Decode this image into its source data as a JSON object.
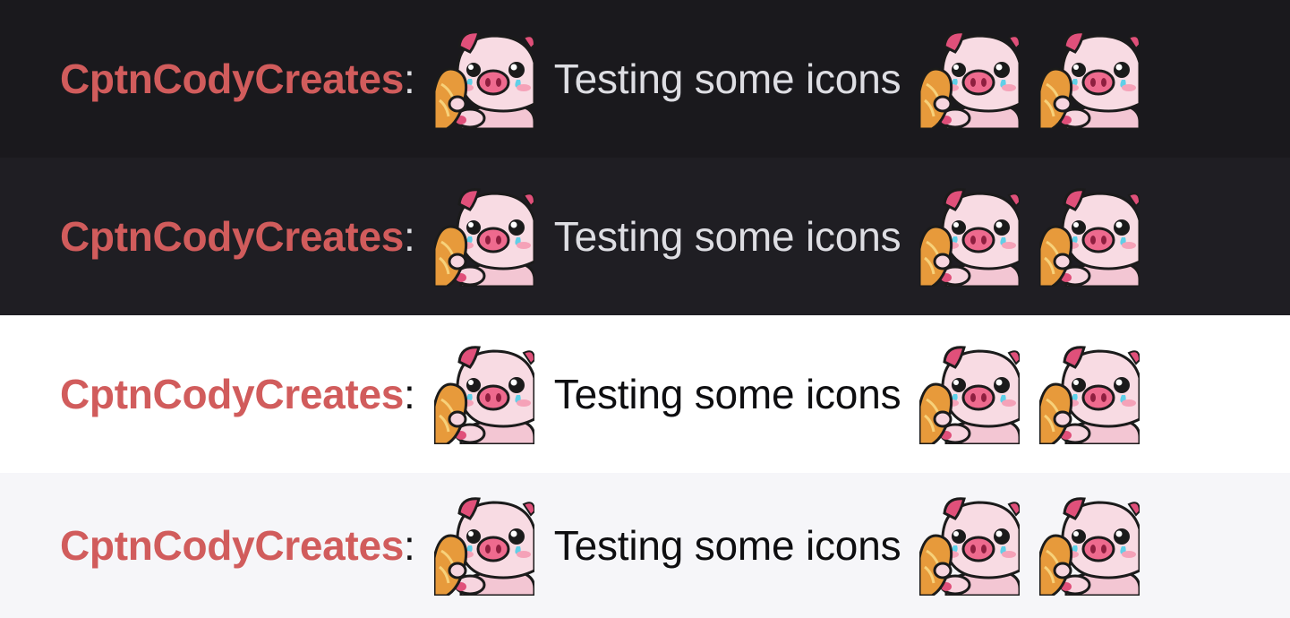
{
  "rows": [
    {
      "theme": "dark",
      "background": "#1a191d",
      "username": "CptnCodyCreates",
      "separator": ":",
      "message": "Testing some icons",
      "emotes": [
        "crying-pig-emote",
        "crying-pig-emote",
        "crying-pig-emote"
      ]
    },
    {
      "theme": "dark",
      "background": "#1f1e23",
      "username": "CptnCodyCreates",
      "separator": ":",
      "message": "Testing some icons",
      "emotes": [
        "crying-pig-emote",
        "crying-pig-emote",
        "crying-pig-emote"
      ]
    },
    {
      "theme": "light",
      "background": "#ffffff",
      "username": "CptnCodyCreates",
      "separator": ":",
      "message": "Testing some icons",
      "emotes": [
        "crying-pig-emote",
        "crying-pig-emote",
        "crying-pig-emote"
      ]
    },
    {
      "theme": "light",
      "background": "#f6f6f9",
      "username": "CptnCodyCreates",
      "separator": ":",
      "message": "Testing some icons",
      "emotes": [
        "crying-pig-emote",
        "crying-pig-emote",
        "crying-pig-emote"
      ]
    }
  ],
  "colors": {
    "username": "#d15c5c",
    "dark_text": "#dedee3",
    "light_text": "#0e0e10"
  }
}
